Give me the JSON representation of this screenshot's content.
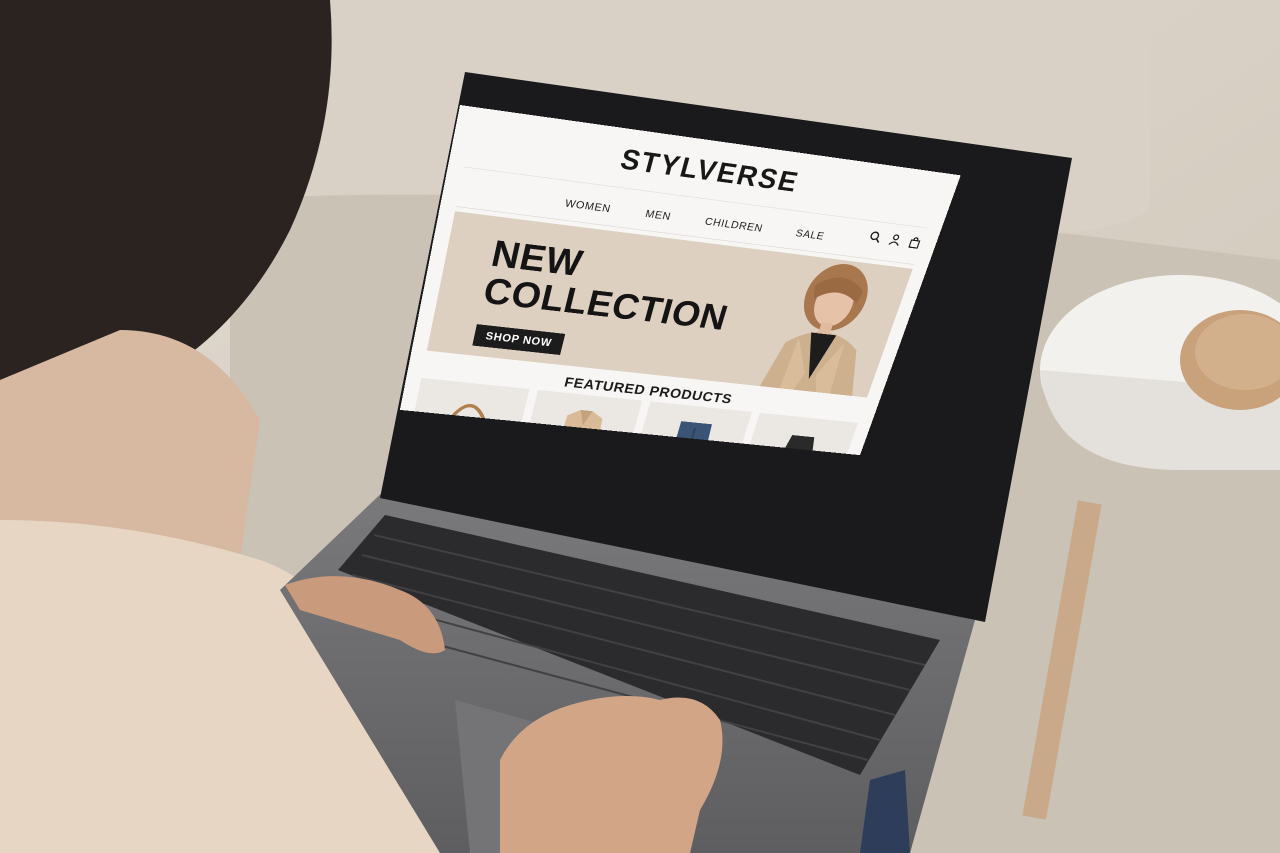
{
  "site": {
    "logo": "STYLVERSE",
    "nav": [
      "WOMEN",
      "MEN",
      "CHILDREN",
      "SALE"
    ],
    "icons": [
      "search-icon",
      "user-icon",
      "shopping-bag-icon"
    ]
  },
  "hero": {
    "title_line1": "NEW",
    "title_line2": "COLLECTION",
    "cta": "SHOP NOW"
  },
  "featured": {
    "heading": "FEATURED PRODUCTS",
    "products": [
      "handbag",
      "beige jacket",
      "denim jeans",
      "black skirt"
    ]
  },
  "colors": {
    "hero_bg": "#ddd0c1",
    "button": "#1c1c1c",
    "sofa": "#d7cfc4",
    "laptop": "#6b6b6d"
  }
}
